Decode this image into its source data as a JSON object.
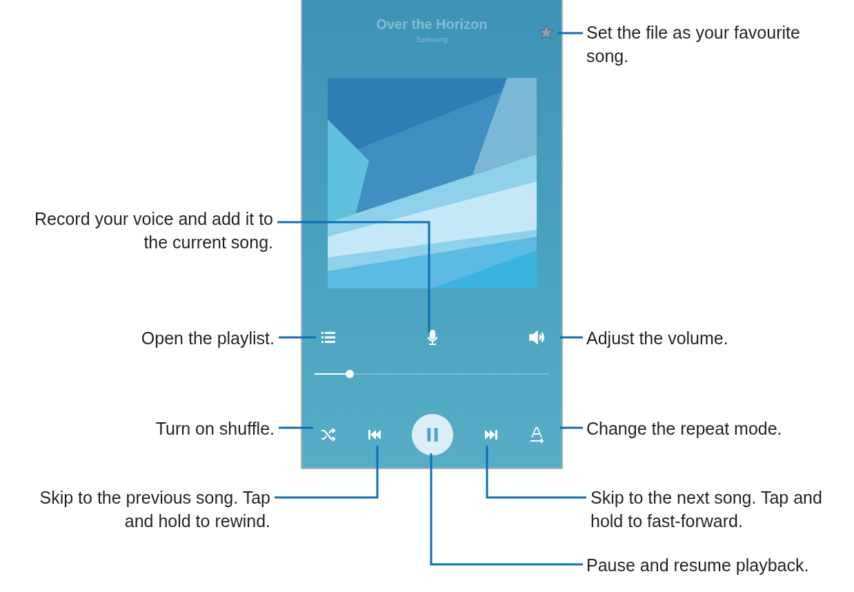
{
  "player": {
    "title": "Over the Horizon",
    "artist": "Samsung",
    "favourite": false,
    "progress": {
      "level": 0.15
    }
  },
  "callouts": [
    {
      "text": "Set the file as your favourite song."
    },
    {
      "text": "Record your voice and add it to the current song."
    },
    {
      "text": "Open the playlist."
    },
    {
      "text": "Adjust the volume."
    },
    {
      "text": "Turn on shuffle."
    },
    {
      "text": "Change the repeat mode."
    },
    {
      "text": "Skip to the previous song. Tap and hold to rewind."
    },
    {
      "text": "Skip to the next song. Tap and hold to fast-forward."
    },
    {
      "text": "Pause and resume playback."
    }
  ]
}
